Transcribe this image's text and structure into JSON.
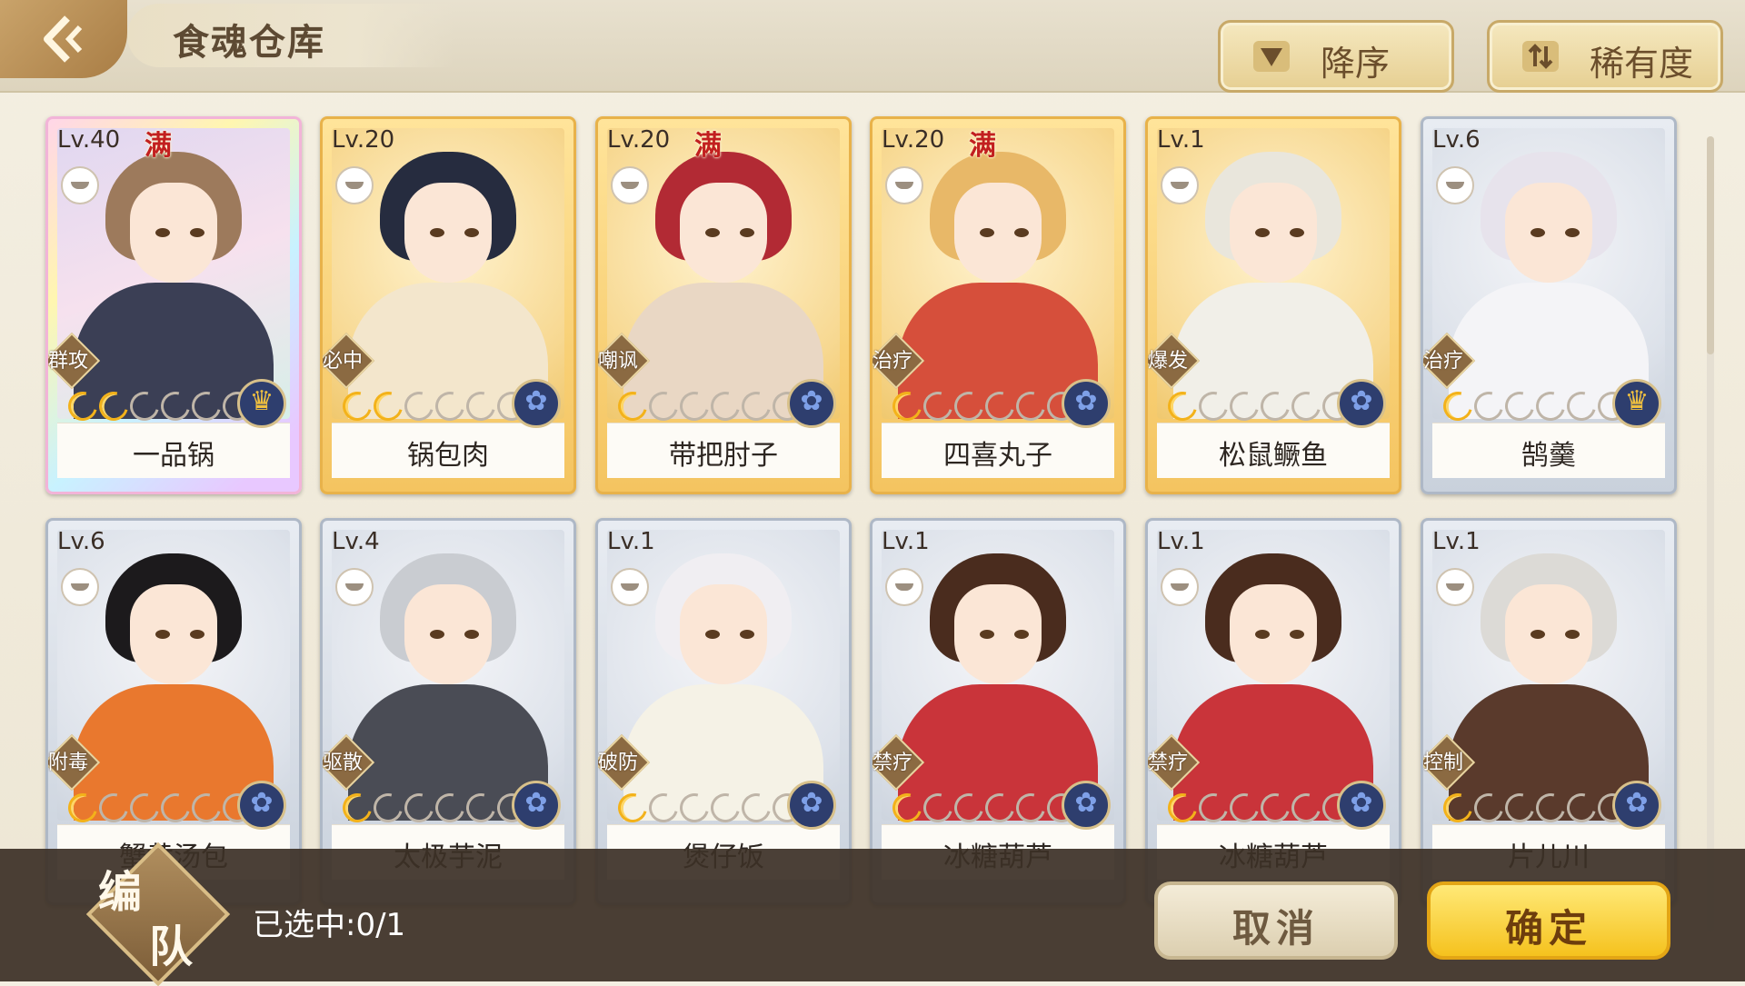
{
  "header": {
    "title": "食魂仓库",
    "sort_order_label": "降序",
    "sort_key_label": "稀有度"
  },
  "cards": [
    {
      "level": "Lv.40",
      "name": "一品锅",
      "role": "群攻",
      "full": "满",
      "stars_on": 2,
      "stars_total": 6,
      "frame": "rainbow",
      "emblem": "gold-emblem-icon",
      "hair": "#9d7a5c",
      "body": "#3b3f55"
    },
    {
      "level": "Lv.20",
      "name": "锅包肉",
      "role": "必中",
      "full": "",
      "stars_on": 2,
      "stars_total": 6,
      "frame": "gold",
      "emblem": "blue-flower-emblem-icon",
      "hair": "#262c3f",
      "body": "#f3e6cc"
    },
    {
      "level": "Lv.20",
      "name": "带把肘子",
      "role": "嘲讽",
      "full": "满",
      "stars_on": 1,
      "stars_total": 6,
      "frame": "gold",
      "emblem": "blue-flower-emblem-icon",
      "hair": "#b22a34",
      "body": "#e9d7c4"
    },
    {
      "level": "Lv.20",
      "name": "四喜丸子",
      "role": "治疗",
      "full": "满",
      "stars_on": 1,
      "stars_total": 6,
      "frame": "gold",
      "emblem": "blue-flower-emblem-icon",
      "hair": "#e8b868",
      "body": "#d64f3b"
    },
    {
      "level": "Lv.1",
      "name": "松鼠鳜鱼",
      "role": "爆发",
      "full": "",
      "stars_on": 1,
      "stars_total": 6,
      "frame": "gold",
      "emblem": "blue-flower-emblem-icon",
      "hair": "#e9e6dc",
      "body": "#f1efe8"
    },
    {
      "level": "Lv.6",
      "name": "鹄羹",
      "role": "治疗",
      "full": "",
      "stars_on": 1,
      "stars_total": 6,
      "frame": "silver",
      "emblem": "gold-emblem-icon",
      "hair": "#e7e3ec",
      "body": "#f4f4f7"
    },
    {
      "level": "Lv.6",
      "name": "蟹黄汤包",
      "role": "附毒",
      "full": "",
      "stars_on": 1,
      "stars_total": 6,
      "frame": "silver",
      "emblem": "blue-flower-emblem-icon",
      "hair": "#1c1a1c",
      "body": "#e9782e"
    },
    {
      "level": "Lv.4",
      "name": "太极芋泥",
      "role": "驱散",
      "full": "",
      "stars_on": 1,
      "stars_total": 6,
      "frame": "silver",
      "emblem": "blue-flower-emblem-icon",
      "hair": "#c9ccd1",
      "body": "#4a4c55"
    },
    {
      "level": "Lv.1",
      "name": "煲仔饭",
      "role": "破防",
      "full": "",
      "stars_on": 1,
      "stars_total": 6,
      "frame": "silver",
      "emblem": "blue-flower-emblem-icon",
      "hair": "#f0eef2",
      "body": "#f5f2e6"
    },
    {
      "level": "Lv.1",
      "name": "冰糖葫芦",
      "role": "禁疗",
      "full": "",
      "stars_on": 1,
      "stars_total": 6,
      "frame": "silver",
      "emblem": "blue-flower-emblem-icon",
      "hair": "#4a2c1e",
      "body": "#c9343a"
    },
    {
      "level": "Lv.1",
      "name": "冰糖葫芦",
      "role": "禁疗",
      "full": "",
      "stars_on": 1,
      "stars_total": 6,
      "frame": "silver",
      "emblem": "blue-flower-emblem-icon",
      "hair": "#4a2c1e",
      "body": "#c9343a"
    },
    {
      "level": "Lv.1",
      "name": "片儿川",
      "role": "控制",
      "full": "",
      "stars_on": 1,
      "stars_total": 6,
      "frame": "silver",
      "emblem": "blue-flower-emblem-icon",
      "hair": "#dcdad6",
      "body": "#5a3a2c"
    }
  ],
  "footer": {
    "team_char1": "编",
    "team_char2": "队",
    "selected_text": "已选中:0/1",
    "cancel_label": "取消",
    "confirm_label": "确定"
  }
}
